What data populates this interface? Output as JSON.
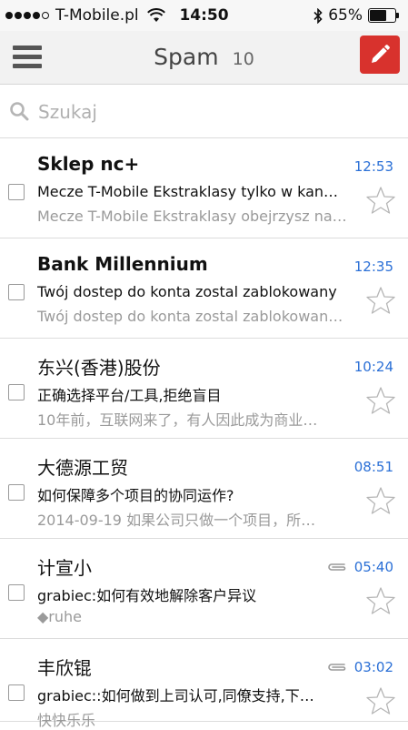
{
  "status_bar": {
    "carrier": "T-Mobile.pl",
    "signal_filled": 4,
    "signal_total": 5,
    "time": "14:50",
    "battery_percent": "65%",
    "battery_level": 0.65
  },
  "header": {
    "title": "Spam",
    "count": "10",
    "compose_color": "#d8322d"
  },
  "search": {
    "placeholder": "Szukaj"
  },
  "colors": {
    "time": "#2a6fd6",
    "snippet": "#9a9a9a"
  },
  "emails": [
    {
      "sender": "Sklep nc+",
      "bold": true,
      "time": "12:53",
      "attachment": false,
      "subject": "Mecze T-Mobile Ekstraklasy tylko w kan…",
      "snippet": "Mecze T-Mobile Ekstraklasy obejrzysz na ż…",
      "starred": false
    },
    {
      "sender": "Bank Millennium",
      "bold": true,
      "time": "12:35",
      "attachment": false,
      "subject": "Twój dostep do konta zostal zablokowany",
      "snippet": "Twój dostep do konta zostal zablokowany …",
      "starred": false
    },
    {
      "sender": "东兴(香港)股份",
      "bold": false,
      "time": "10:24",
      "attachment": false,
      "subject": "正确选择平台/工具,拒绝盲目",
      "snippet": "10年前，互联网来了，有人因此成为商业…",
      "starred": false
    },
    {
      "sender": "大德源工贸",
      "bold": false,
      "time": "08:51",
      "attachment": false,
      "subject": "如何保障多个项目的协同运作?",
      "snippet": "2014-09-19 如果公司只做一个项目，所…",
      "starred": false
    },
    {
      "sender": "计宣小",
      "bold": false,
      "time": "05:40",
      "attachment": true,
      "subject": "grabiec:如何有效地解除客户异议",
      "snippet": "◆ruhe",
      "starred": false
    },
    {
      "sender": "丰欣锟",
      "bold": false,
      "time": "03:02",
      "attachment": true,
      "subject": "grabiec::如何做到上司认可,同僚支持,下…",
      "snippet": "快快乐乐",
      "starred": false
    }
  ]
}
